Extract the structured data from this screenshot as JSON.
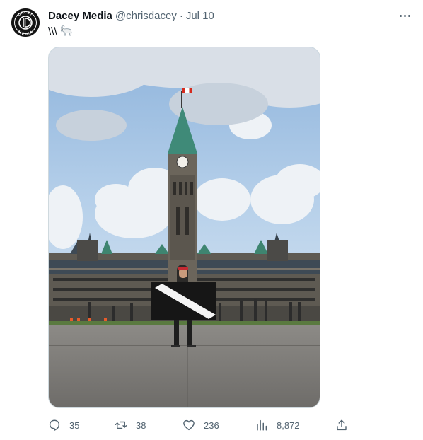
{
  "author": {
    "name": "Dacey Media",
    "handle": "@chrisdacey",
    "separator": "·",
    "date": "Jul 10",
    "avatar_text_top": "DACEY",
    "avatar_text_bottom": "MEDIA"
  },
  "tweet": {
    "text": "\\\\\\",
    "emoji_icon": "goat-icon"
  },
  "media": {
    "alt_description_visible": false,
    "icons": [
      "canadian-flag",
      "clock-face"
    ]
  },
  "actions": {
    "reply_count": "35",
    "retweet_count": "38",
    "like_count": "236",
    "view_count": "8,872"
  },
  "icons": {
    "more": "more-icon",
    "reply": "reply-icon",
    "retweet": "retweet-icon",
    "like": "heart-icon",
    "views": "views-icon",
    "share": "share-icon"
  },
  "colors": {
    "text_primary": "#0f1419",
    "text_secondary": "#536471",
    "border": "#cfd9de",
    "sky": "#9cc0e4",
    "tower_roof": "#3f8a78",
    "flag_red": "#d52b1e"
  }
}
